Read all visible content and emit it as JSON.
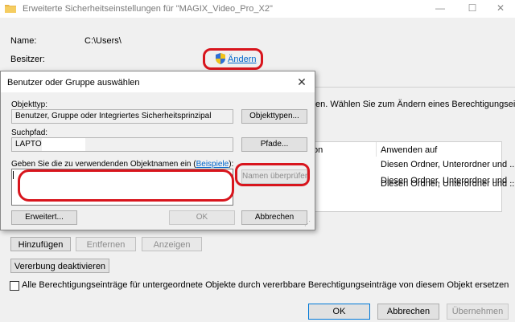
{
  "window": {
    "title": "Erweiterte Sicherheitseinstellungen für \"MAGIX_Video_Pro_X2\"",
    "minimize_glyph": "—",
    "maximize_glyph": "☐",
    "close_glyph": "✕"
  },
  "properties": {
    "name_label": "Name:",
    "name_value": "C:\\Users\\",
    "owner_label": "Besitzer:",
    "change_link": "Ändern"
  },
  "main": {
    "info_text": "en. Wählen Sie zum Ändern eines Berechtigungseintrags",
    "columns": [
      "on",
      "Anwenden auf"
    ],
    "rows": [
      "Diesen Ordner, Unterordner und ...",
      "Diesen Ordner, Unterordner und ...",
      "Diesen Ordner, Unterordner und ..."
    ],
    "add_button": "Hinzufügen",
    "remove_button": "Entfernen",
    "view_button": "Anzeigen",
    "disable_inheritance_button": "Vererbung deaktivieren",
    "replace_checkbox_label": "Alle Berechtigungseinträge für untergeordnete Objekte durch vererbbare Berechtigungseinträge von diesem Objekt ersetzen",
    "ok_button": "OK",
    "cancel_button": "Abbrechen",
    "apply_button": "Übernehmen"
  },
  "dialog": {
    "title": "Benutzer oder Gruppe auswählen",
    "close_glyph": "✕",
    "object_type_label": "Objekttyp:",
    "object_type_value": "Benutzer, Gruppe oder Integriertes Sicherheitsprinzipal",
    "object_types_button": "Objekttypen...",
    "search_path_label": "Suchpfad:",
    "search_path_value": "LAPTOP-",
    "paths_button": "Pfade...",
    "enter_names_prefix": "Geben Sie die zu verwendenden Objektnamen ein (",
    "examples_link": "Beispiele",
    "enter_names_suffix": "):",
    "check_names_button": "Namen überprüfen",
    "advanced_button": "Erweitert...",
    "ok_button": "OK",
    "cancel_button": "Abbrechen"
  },
  "colors": {
    "annotation_red": "#d8151d",
    "link_blue": "#0066cc"
  }
}
